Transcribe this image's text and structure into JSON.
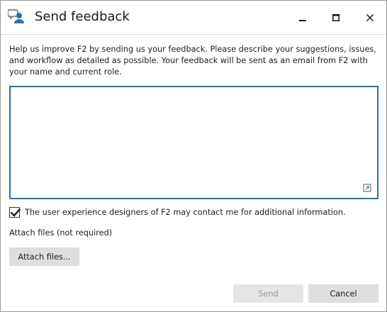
{
  "window": {
    "title": "Send feedback",
    "controls": {
      "minimize": "minimize-icon",
      "maximize": "maximize-icon",
      "close": "close-icon"
    }
  },
  "description": "Help us improve F2 by sending us your feedback. Please describe your suggestions, issues, and workflow as detailed as possible. Your feedback will be sent as an email from F2 with your name and current role.",
  "feedback": {
    "value": "",
    "placeholder": ""
  },
  "contact_permission": {
    "checked": true,
    "label": "The user experience designers of F2 may contact me for additional information."
  },
  "attachments": {
    "label": "Attach files (not required)",
    "button_label": "Attach files..."
  },
  "footer": {
    "send_label": "Send",
    "send_enabled": false,
    "cancel_label": "Cancel"
  },
  "colors": {
    "accent": "#2a6fc0",
    "button_bg": "#dedede",
    "disabled_text": "#9a9a9a"
  }
}
